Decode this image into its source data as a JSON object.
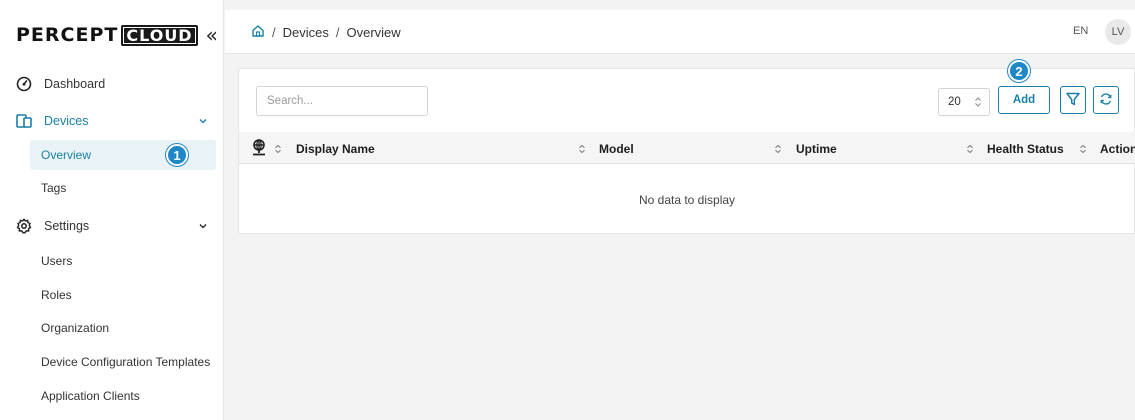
{
  "logo": {
    "word1": "PERCEPT",
    "word2": "CLOUD",
    "collapse": "«"
  },
  "sidebar": {
    "dashboard": "Dashboard",
    "devices": "Devices",
    "devices_children": [
      "Overview",
      "Tags"
    ],
    "settings": "Settings",
    "settings_children": [
      "Users",
      "Roles",
      "Organization",
      "Device Configuration Templates",
      "Application Clients"
    ]
  },
  "badges": {
    "one": "1",
    "two": "2"
  },
  "breadcrumb": {
    "home_icon": "home-icon",
    "items": [
      "Devices",
      "Overview"
    ],
    "separator": "/"
  },
  "topbar": {
    "language": "EN",
    "avatar_initials": "LV"
  },
  "toolbar": {
    "search_placeholder": "Search...",
    "search_value": "",
    "page_size": "20",
    "add_label": "Add"
  },
  "table": {
    "columns": [
      "Display Name",
      "Model",
      "Uptime",
      "Health Status",
      "Actions"
    ],
    "rows": [],
    "empty_text": "No data to display"
  },
  "colors": {
    "accent": "#1a7fa6",
    "badge": "#1f86c7",
    "selected_bg": "#e9f3f7"
  }
}
